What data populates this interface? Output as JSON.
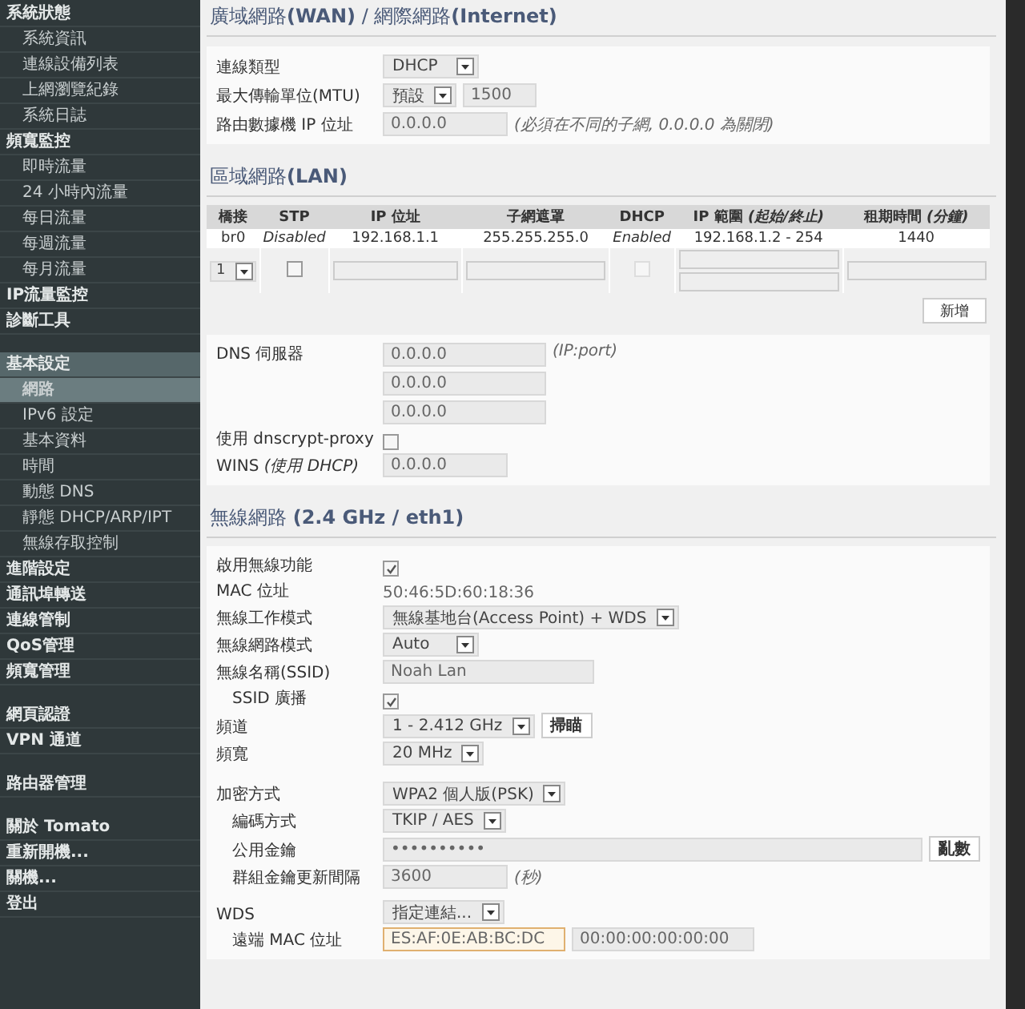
{
  "sidebar": [
    {
      "label": "系統狀態",
      "selected": false,
      "children": [
        {
          "label": "系統資訊",
          "selected": false
        },
        {
          "label": "連線設備列表",
          "selected": false
        },
        {
          "label": "上網瀏覽紀錄",
          "selected": false
        },
        {
          "label": "系統日誌",
          "selected": false
        }
      ]
    },
    {
      "label": "頻寬監控",
      "selected": false,
      "children": [
        {
          "label": "即時流量",
          "selected": false
        },
        {
          "label": "24 小時內流量",
          "selected": false
        },
        {
          "label": "每日流量",
          "selected": false
        },
        {
          "label": "每週流量",
          "selected": false
        },
        {
          "label": "每月流量",
          "selected": false
        }
      ]
    },
    {
      "label": "IP流量監控",
      "selected": false
    },
    {
      "label": "診斷工具",
      "selected": false
    },
    {
      "label": "基本設定",
      "selected": true,
      "gap_before": true,
      "children": [
        {
          "label": "網路",
          "selected": true
        },
        {
          "label": "IPv6 設定",
          "selected": false
        },
        {
          "label": "基本資料",
          "selected": false
        },
        {
          "label": "時間",
          "selected": false
        },
        {
          "label": "動態 DNS",
          "selected": false
        },
        {
          "label": "靜態 DHCP/ARP/IPT",
          "selected": false
        },
        {
          "label": "無線存取控制",
          "selected": false
        }
      ]
    },
    {
      "label": "進階設定",
      "selected": false
    },
    {
      "label": "通訊埠轉送",
      "selected": false
    },
    {
      "label": "連線管制",
      "selected": false
    },
    {
      "label": "QoS管理",
      "selected": false
    },
    {
      "label": "頻寬管理",
      "selected": false
    },
    {
      "label": "網頁認證",
      "selected": false,
      "gap_before": true
    },
    {
      "label": "VPN 通道",
      "selected": false
    },
    {
      "label": "路由器管理",
      "selected": false,
      "gap_before": true
    },
    {
      "label": "關於 Tomato",
      "selected": false,
      "gap_before": true
    },
    {
      "label": "重新開機...",
      "selected": false
    },
    {
      "label": "關機...",
      "selected": false
    },
    {
      "label": "登出",
      "selected": false
    }
  ],
  "wan": {
    "title": "廣域網路**(WAN)** / 網際網路**(Internet)**",
    "rows": [
      {
        "label": "連線類型",
        "kind": "select",
        "value": "DHCP"
      },
      {
        "label": "最大傳輸單位(MTU)",
        "kind": "select_input",
        "value": "預設",
        "input": "1500"
      },
      {
        "label": "路由數據機 IP 位址",
        "kind": "input",
        "value": "0.0.0.0",
        "note": "(必須在不同的子網, 0.0.0.0 為關閉)"
      }
    ]
  },
  "lan": {
    "title": "區域網路**(LAN)**",
    "columns": [
      "橋接",
      "STP",
      "IP 位址",
      "子網遮罩",
      "DHCP",
      "IP 範圍 *(起始/終止)*",
      "租期時間 *(分鐘)*"
    ],
    "rows": [
      {
        "cells": [
          "br0",
          "*Disabled*",
          "192.168.1.1",
          "255.255.255.0",
          "*Enabled*",
          "192.168.1.2 - 254",
          "1440"
        ]
      }
    ],
    "new_row": {
      "bridge": "1",
      "stp_checked": false,
      "dhcp_checked": false,
      "dhcp_disabled": true
    },
    "add_button": "新增",
    "rows_after": [
      {
        "label": "DNS 伺服器",
        "kind": "inputs",
        "values": [
          "0.0.0.0",
          "0.0.0.0",
          "0.0.0.0"
        ],
        "note": "(IP:port)"
      },
      {
        "label": "使用 dnscrypt-proxy",
        "kind": "checkbox",
        "checked": false
      },
      {
        "label": "WINS *(使用 DHCP)*",
        "kind": "input",
        "value": "0.0.0.0"
      }
    ]
  },
  "wireless": {
    "title": "無線網路 **(2.4 GHz / eth1)**",
    "rows": [
      {
        "label": "啟用無線功能",
        "kind": "checkbox",
        "checked": true
      },
      {
        "label": "MAC 位址",
        "kind": "text",
        "value": "50:46:5D:60:18:36"
      },
      {
        "label": "無線工作模式",
        "kind": "select",
        "value": "無線基地台(Access Point) + WDS"
      },
      {
        "label": "無線網路模式",
        "kind": "select",
        "value": "Auto"
      },
      {
        "label": "無線名稱(SSID)",
        "kind": "name_input",
        "value": "Noah Lan"
      },
      {
        "label": "SSID 廣播",
        "kind": "checkbox",
        "checked": true,
        "indented": true
      },
      {
        "label": "頻道",
        "kind": "select_button",
        "value": "1 - 2.412 GHz",
        "button": "掃瞄"
      },
      {
        "label": "頻寬",
        "kind": "select",
        "value": "20 MHz"
      },
      {
        "label": "加密方式",
        "kind": "select",
        "value": "WPA2 個人版(PSK)",
        "gap_before": true
      },
      {
        "label": "編碼方式",
        "kind": "select",
        "value": "TKIP / AES",
        "indented": true
      },
      {
        "label": "公用金鑰",
        "kind": "input_button",
        "value": "••••••••••",
        "button": "亂數",
        "indented": true
      },
      {
        "label": "群組金鑰更新間隔",
        "kind": "input",
        "value": "3600",
        "note": "(秒)",
        "indented": true
      },
      {
        "label": "WDS",
        "kind": "select",
        "value": "指定連結...",
        "gap_before": true
      },
      {
        "label": "遠端 MAC 位址",
        "kind": "input_pair",
        "values": [
          "ES:AF:0E:AB:BC:DC",
          "00:00:00:00:00:00"
        ],
        "focused": [
          true,
          false
        ],
        "indented": true
      }
    ]
  }
}
